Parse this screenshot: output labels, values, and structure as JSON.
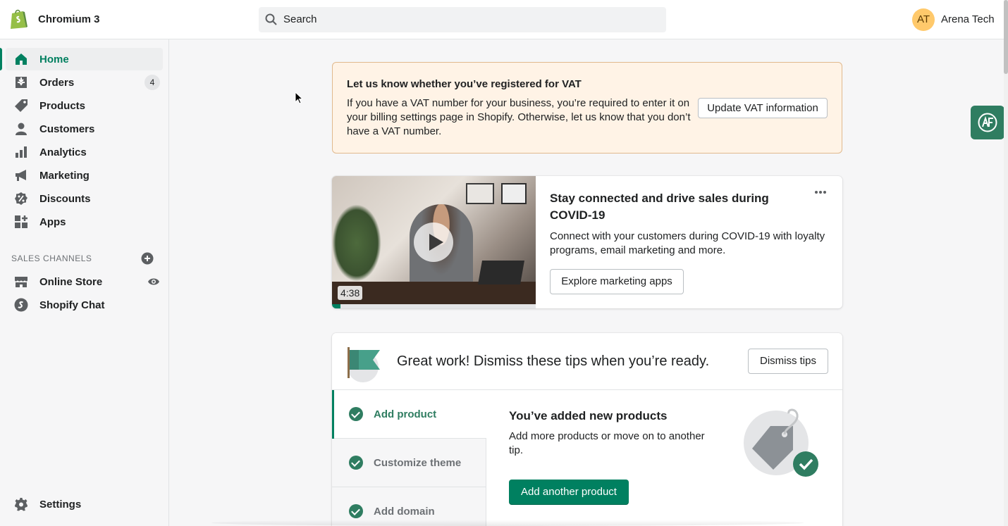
{
  "header": {
    "store_name": "Chromium 3",
    "search_placeholder": "Search",
    "avatar_initials": "AT",
    "user_name": "Arena Tech"
  },
  "sidebar": {
    "items": [
      {
        "label": "Home",
        "icon": "home-icon",
        "active": true
      },
      {
        "label": "Orders",
        "icon": "orders-icon",
        "badge": "4"
      },
      {
        "label": "Products",
        "icon": "tag-icon"
      },
      {
        "label": "Customers",
        "icon": "person-icon"
      },
      {
        "label": "Analytics",
        "icon": "bar-chart-icon"
      },
      {
        "label": "Marketing",
        "icon": "megaphone-icon"
      },
      {
        "label": "Discounts",
        "icon": "discount-icon"
      },
      {
        "label": "Apps",
        "icon": "apps-icon"
      }
    ],
    "sales_channels_title": "SALES CHANNELS",
    "channels": [
      {
        "label": "Online Store",
        "icon": "store-icon"
      },
      {
        "label": "Shopify Chat",
        "icon": "shopify-chat-icon"
      }
    ],
    "settings_label": "Settings"
  },
  "vat_banner": {
    "title": "Let us know whether you’ve registered for VAT",
    "body": "If you have a VAT number for your business, you’re required to enter it on your billing settings page in Shopify. Otherwise, let us know that you don’t have a VAT number.",
    "button": "Update VAT information"
  },
  "covid_card": {
    "title": "Stay connected and drive sales during COVID-19",
    "body": "Connect with your customers during COVID-19 with loyalty programs, email marketing and more.",
    "button": "Explore marketing apps",
    "video_duration": "4:38",
    "video_progress": 0.04
  },
  "tips_card": {
    "title": "Great work! Dismiss these tips when you’re ready.",
    "dismiss_button": "Dismiss tips",
    "tabs": [
      {
        "label": "Add product",
        "done": true,
        "active": true
      },
      {
        "label": "Customize theme",
        "done": true
      },
      {
        "label": "Add domain",
        "done": true
      }
    ],
    "content_title": "You’ve added new products",
    "content_body": "Add more products or move on to another tip.",
    "content_button": "Add another product"
  },
  "colors": {
    "brand_green": "#008060",
    "vat_background": "#fff3e6",
    "avatar": "#ffc96b"
  }
}
